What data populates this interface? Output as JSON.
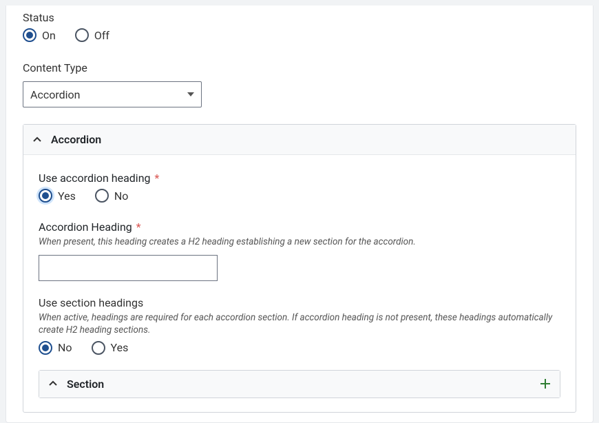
{
  "status": {
    "label": "Status",
    "options": {
      "on": "On",
      "off": "Off"
    },
    "value": "on"
  },
  "content_type": {
    "label": "Content Type",
    "value": "Accordion"
  },
  "accordion_panel": {
    "title": "Accordion",
    "use_accordion_heading": {
      "label": "Use accordion heading",
      "options": {
        "yes": "Yes",
        "no": "No"
      },
      "value": "yes"
    },
    "accordion_heading": {
      "label": "Accordion Heading",
      "help": "When present, this heading creates a H2 heading establishing a new section for the accordion.",
      "value": ""
    },
    "use_section_headings": {
      "label": "Use section headings",
      "help": "When active, headings are required for each accordion section. If accordion heading is not present, these headings automatically create H2 heading sections.",
      "options": {
        "no": "No",
        "yes": "Yes"
      },
      "value": "no"
    },
    "section_panel": {
      "title": "Section"
    }
  }
}
